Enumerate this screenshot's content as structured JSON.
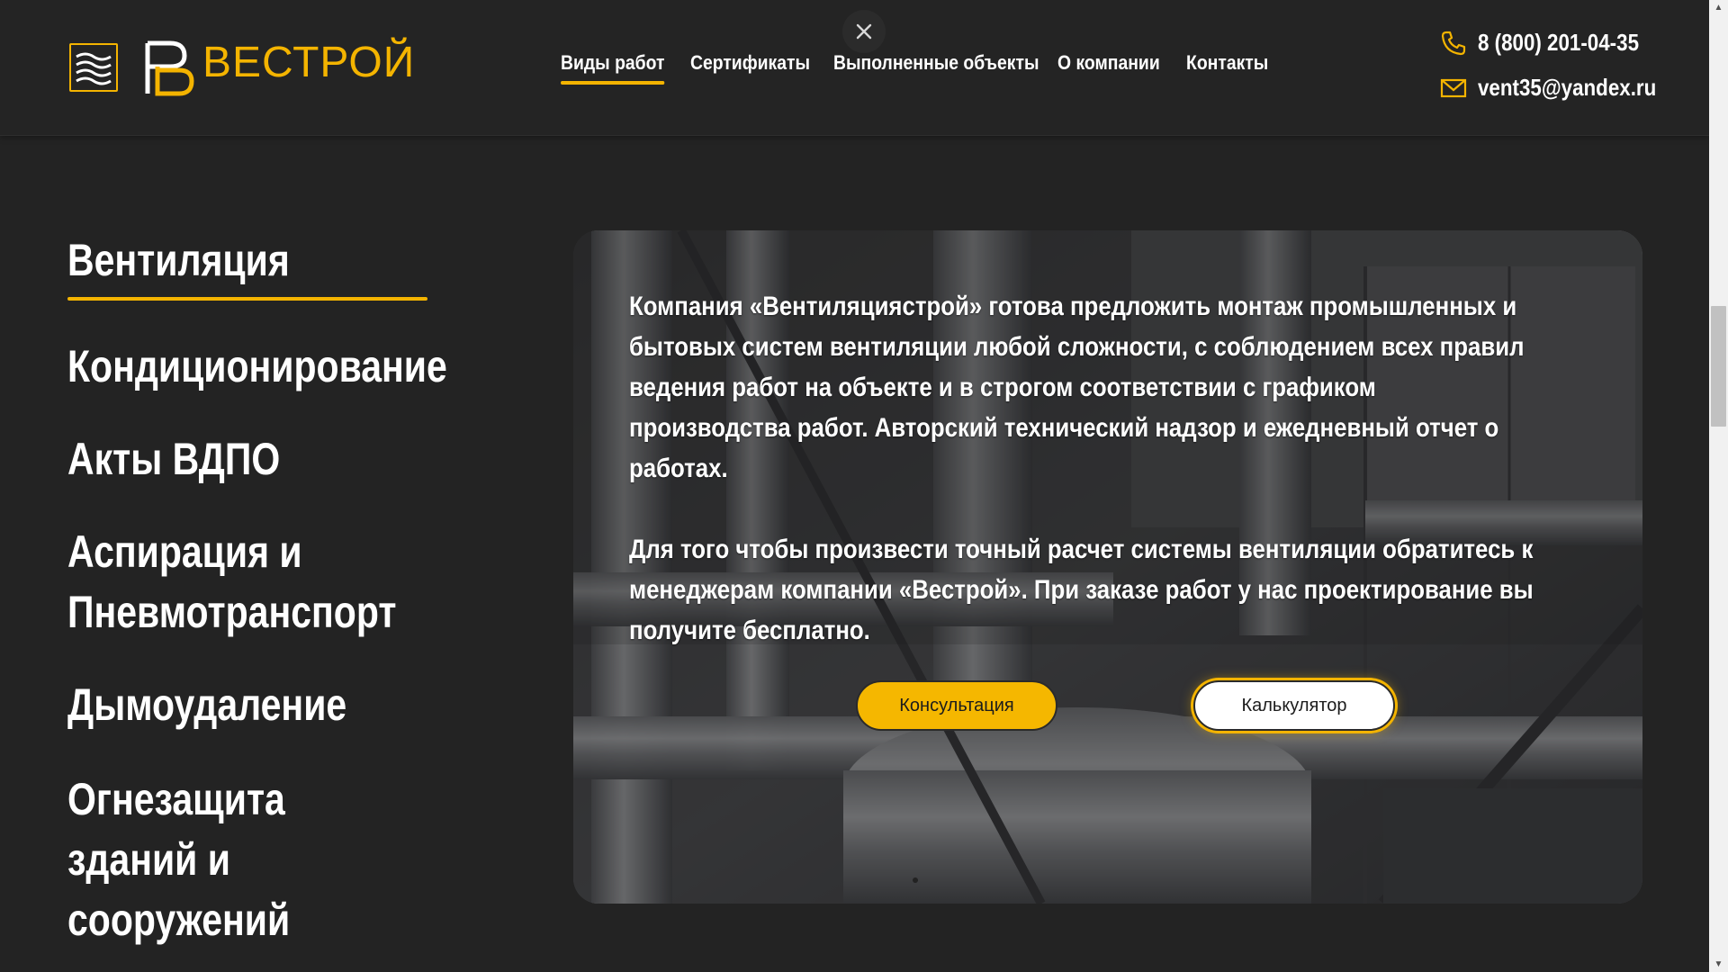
{
  "header": {
    "logo_alt_text": "ВЕСТРОЙ",
    "nav": [
      {
        "label": "Виды работ",
        "active": true
      },
      {
        "label": "Сертификаты",
        "active": false
      },
      {
        "label": "Выполненные объекты",
        "active": false
      },
      {
        "label": "О компании",
        "active": false
      },
      {
        "label": "Контакты",
        "active": false
      }
    ],
    "phone": "8 (800) 201-04-35",
    "email": "vent35@yandex.ru",
    "close_icon": "close-icon",
    "phone_icon": "phone-icon",
    "email_icon": "mail-icon"
  },
  "sidebar": {
    "items": [
      {
        "label": "Вентиляция",
        "active": true
      },
      {
        "label": "Кондиционирование",
        "active": false
      },
      {
        "label": "Акты ВДПО",
        "active": false
      },
      {
        "label": "Аспирация и Пневмотранспорт",
        "active": false
      },
      {
        "label": "Дымоудаление",
        "active": false
      },
      {
        "label": "Огнезащита зданий и сооружений",
        "active": false
      }
    ]
  },
  "hero": {
    "paragraph1": "Компания «Вентиляциястрой» готова предложить монтаж промышленных и бытовых систем вентиляции любой сложности, с соблюдением всех правил ведения работ на объекте и в строгом соответствии с графиком производства работ. Авторский технический надзор и ежедневный отчет о работах.",
    "paragraph2": "Для того чтобы произвести точный расчет системы вентиляции обратитесь к менеджерам компании «Вестрой». При заказе работ у нас проектирование вы получите бесплатно.",
    "consult_button": "Консультация",
    "calc_button": "Калькулятор"
  },
  "colors": {
    "accent": "#f4b400",
    "background": "#232323",
    "text": "#ffffff"
  }
}
